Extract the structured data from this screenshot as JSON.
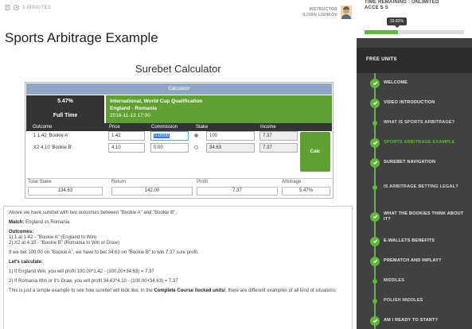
{
  "meta": {
    "duration": "3 MINUTES"
  },
  "instructor": {
    "label": "INSTRUCTOR",
    "name": "ILIYAN LISHKOV"
  },
  "page_title": "Sports Arbitrage Example",
  "sidebar": {
    "time_remaining": "TIME REMAINING : UNLIMITED",
    "access": "ACCE S S",
    "progress_label": "33.82%",
    "progress": 0.3382,
    "header": "FREE UNITS",
    "items": [
      {
        "label": "WELCOME",
        "kind": "done"
      },
      {
        "label": "VIDEO INTRODUCTION",
        "kind": "done"
      },
      {
        "label": "WHAT IS SPORTS ARBITRAGE?",
        "kind": "sub"
      },
      {
        "label": "SPORTS ARBITRAGE EXAMPLE",
        "kind": "active"
      },
      {
        "label": "SUREBET NAVIGATION",
        "kind": "done"
      },
      {
        "label": "IS ARBITRAGE BETTING LEGAL?",
        "kind": "sub"
      },
      {
        "label": "WHAT THE BOOKIES THINK ABOUT IT?",
        "kind": "done"
      },
      {
        "label": "E-WALLETS BENEFITS",
        "kind": "done"
      },
      {
        "label": "PREMATCH AND INPLAY?",
        "kind": "done"
      },
      {
        "label": "MIDDLES",
        "kind": "sub"
      },
      {
        "label": "POLISH MIDDLES",
        "kind": "sub"
      },
      {
        "label": "AM I READY TO START?",
        "kind": "done"
      }
    ]
  },
  "calculator": {
    "title": "Surebet Calculator",
    "header": "Calculator",
    "percent": "5.47%",
    "period": "Full Time",
    "competition": "International, World Cup Qualification",
    "match": "England - Romania",
    "date": "2016-11-13 17:00",
    "columns": {
      "outcome": "Outcome",
      "price": "Price",
      "commission": "Commission",
      "stake": "Stake",
      "income": "Income"
    },
    "rows": [
      {
        "outcome": "1 1.42 'Bookie A'",
        "price": "1.42",
        "commission": "0.0000",
        "stake": "100",
        "income": "7.37"
      },
      {
        "outcome": "X2 4.10 'Bookie B'",
        "price": "4.10",
        "commission": "0.00",
        "stake": "34.63",
        "income": "7.37"
      }
    ],
    "calc_button": "Calc",
    "summary": {
      "total_stake_label": "Total Stake",
      "total_stake": "134.63",
      "return_label": "Return",
      "return": "142.00",
      "profit_label": "Profit",
      "profit": "7.37",
      "arbitrage_label": "Arbitrage",
      "arbitrage": "5.47%"
    }
  },
  "explain": {
    "intro": "Above we have surebet with two outcomes between \"Bookie A\" and \"Bookie B\".",
    "match_label": "Match:",
    "match_text": "England vs Romania",
    "outcomes_label": "Outcomes:",
    "outcome_1": "1) 1 at 1.42 - \"Bookie A\" (England to Win)",
    "outcome_2": "2) X2 at 4.10 - \"Bookie B\" (Romania to Win or Draw)",
    "bet_text": "If we bet 100.00 on \"Bookie A\", we have to bet 34.63 on \"Bookie B\" to win 7.37 sure profit.",
    "calc_label": "Let's calculate:",
    "calc_1": "1) If England Win, you will profit 100.00*1.42 - (100.00+34.63) = 7.37",
    "calc_2": "2) If Romania Win or it's Draw, you will profit 34.63*4.10 - (100.00+34.63) = 7.37",
    "outro_a": "This is just a simple example to see how surebet will look like. In the",
    "outro_b": "Complete Course /locked units/",
    "outro_c": ", there are different examples of all kind of situations."
  }
}
